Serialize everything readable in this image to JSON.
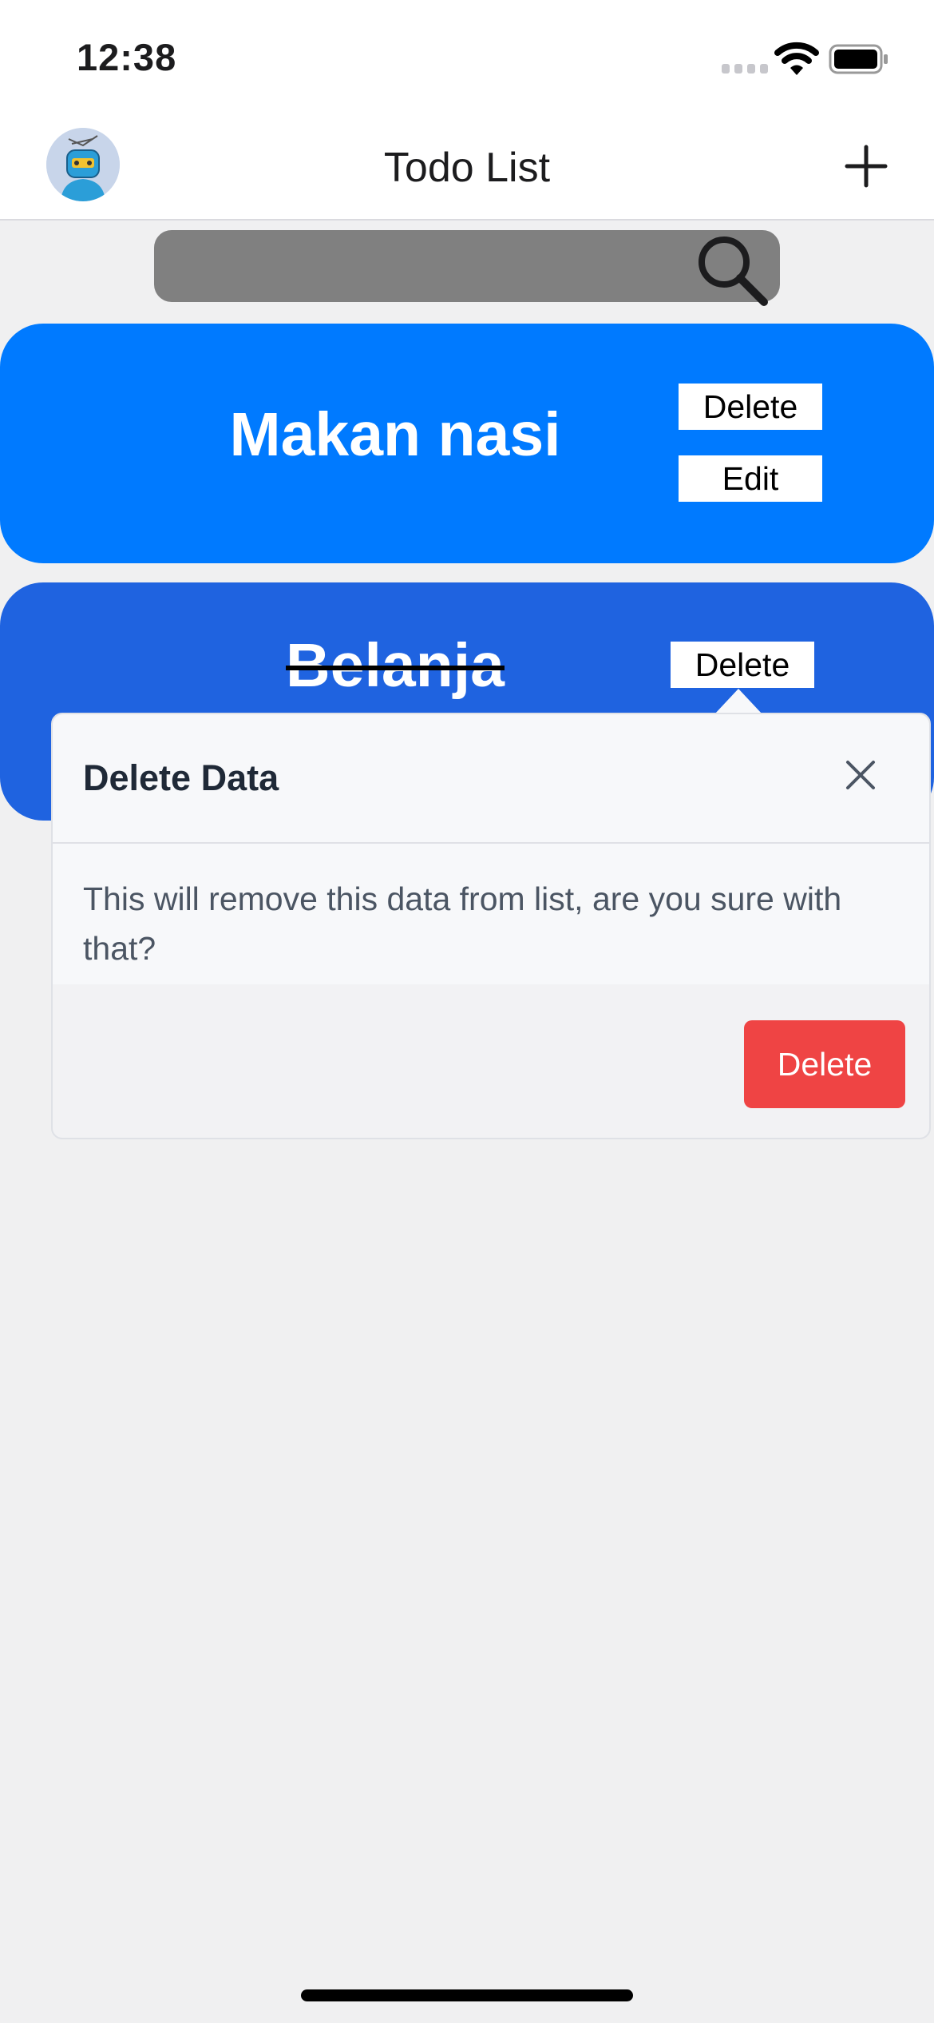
{
  "status_bar": {
    "time": "12:38"
  },
  "nav": {
    "title": "Todo List"
  },
  "search": {
    "placeholder": ""
  },
  "todos": [
    {
      "title": "Makan nasi",
      "completed": false,
      "delete_label": "Delete",
      "edit_label": "Edit"
    },
    {
      "title": "Belanja",
      "completed": true,
      "delete_label": "Delete"
    }
  ],
  "popover": {
    "title": "Delete Data",
    "message": "This will remove this data from list, are you sure with that?",
    "confirm_label": "Delete"
  },
  "colors": {
    "card_primary": "#007aff",
    "card_completed": "#1f63e0",
    "danger": "#ef4444",
    "search_bg": "#808080"
  },
  "icons": [
    "avatar",
    "add-icon",
    "search-icon",
    "close-icon",
    "wifi-icon",
    "battery-icon"
  ]
}
